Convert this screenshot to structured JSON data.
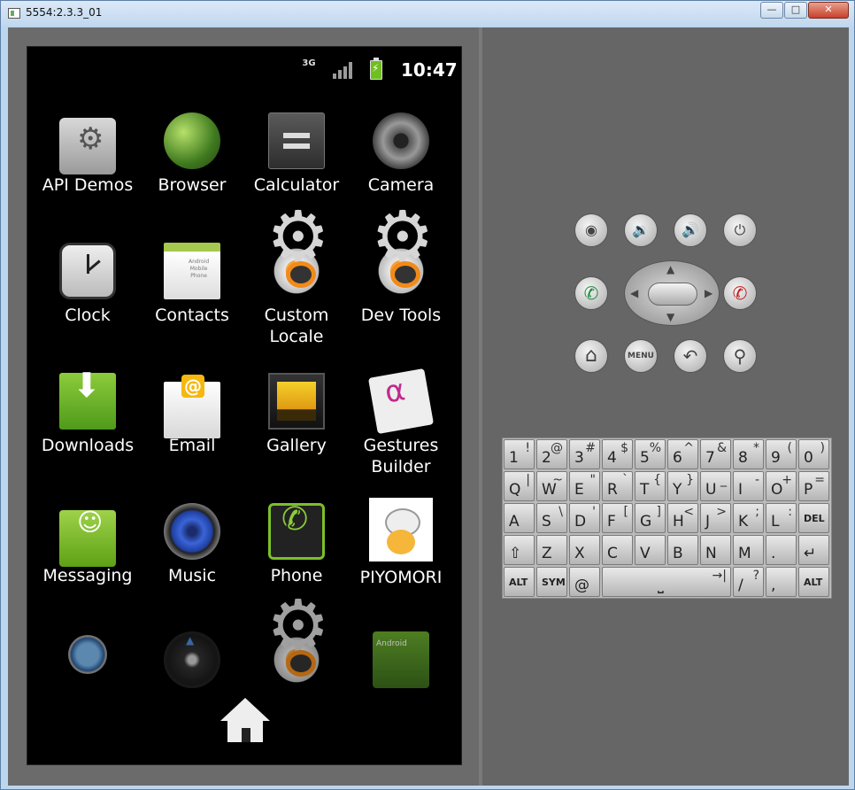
{
  "window": {
    "title": "5554:2.3.3_01",
    "minimize": "—",
    "maximize": "□",
    "close": "✕"
  },
  "status_bar": {
    "network": "3G",
    "time": "10:47"
  },
  "apps": [
    {
      "label": "API Demos",
      "icon": "folder-gear-icon"
    },
    {
      "label": "Browser",
      "icon": "globe-icon"
    },
    {
      "label": "Calculator",
      "icon": "calculator-icon"
    },
    {
      "label": "Camera",
      "icon": "camera-lens-icon"
    },
    {
      "label": "Clock",
      "icon": "clock-icon"
    },
    {
      "label": "Contacts",
      "icon": "contacts-card-icon"
    },
    {
      "label": "Custom\nLocale",
      "icon": "gear-icon"
    },
    {
      "label": "Dev Tools",
      "icon": "gear-icon"
    },
    {
      "label": "Downloads",
      "icon": "download-icon"
    },
    {
      "label": "Email",
      "icon": "envelope-icon"
    },
    {
      "label": "Gallery",
      "icon": "picture-frame-icon"
    },
    {
      "label": "Gestures\nBuilder",
      "icon": "gesture-icon"
    },
    {
      "label": "Messaging",
      "icon": "speech-bubble-icon"
    },
    {
      "label": "Music",
      "icon": "speaker-icon"
    },
    {
      "label": "Phone",
      "icon": "phone-handset-icon"
    },
    {
      "label": "PIYOMORI",
      "icon": "chick-icon"
    }
  ],
  "controls": {
    "camera": "◉",
    "volume_down": "🔉",
    "volume_up": "🔊",
    "power": "⏻",
    "call": "✆",
    "end_call": "✆",
    "home": "⌂",
    "menu": "MENU",
    "back": "↶",
    "search": "⚲",
    "up": "▲",
    "down": "▼",
    "left": "◀",
    "right": "▶"
  },
  "keyboard": {
    "row1": [
      {
        "m": "1",
        "a": "!"
      },
      {
        "m": "2",
        "a": "@"
      },
      {
        "m": "3",
        "a": "#"
      },
      {
        "m": "4",
        "a": "$"
      },
      {
        "m": "5",
        "a": "%"
      },
      {
        "m": "6",
        "a": "^"
      },
      {
        "m": "7",
        "a": "&"
      },
      {
        "m": "8",
        "a": "*"
      },
      {
        "m": "9",
        "a": "("
      },
      {
        "m": "0",
        "a": ")"
      }
    ],
    "row2": [
      {
        "m": "Q",
        "a": "|"
      },
      {
        "m": "W",
        "a": "~"
      },
      {
        "m": "E",
        "a": "\""
      },
      {
        "m": "R",
        "a": "`"
      },
      {
        "m": "T",
        "a": "{"
      },
      {
        "m": "Y",
        "a": "}"
      },
      {
        "m": "U",
        "a": "_"
      },
      {
        "m": "I",
        "a": "-"
      },
      {
        "m": "O",
        "a": "+"
      },
      {
        "m": "P",
        "a": "="
      }
    ],
    "row3": [
      {
        "m": "A",
        "a": ""
      },
      {
        "m": "S",
        "a": "\\"
      },
      {
        "m": "D",
        "a": "'"
      },
      {
        "m": "F",
        "a": "["
      },
      {
        "m": "G",
        "a": "]"
      },
      {
        "m": "H",
        "a": "<"
      },
      {
        "m": "J",
        "a": ">"
      },
      {
        "m": "K",
        "a": ";"
      },
      {
        "m": "L",
        "a": ":"
      },
      {
        "m": "DEL",
        "a": ""
      }
    ],
    "row4": [
      {
        "m": "⇧",
        "a": ""
      },
      {
        "m": "Z",
        "a": ""
      },
      {
        "m": "X",
        "a": ""
      },
      {
        "m": "C",
        "a": ""
      },
      {
        "m": "V",
        "a": ""
      },
      {
        "m": "B",
        "a": ""
      },
      {
        "m": "N",
        "a": ""
      },
      {
        "m": "M",
        "a": ""
      },
      {
        "m": ".",
        "a": ""
      },
      {
        "m": "↵",
        "a": ""
      }
    ],
    "row5": [
      {
        "m": "ALT",
        "a": ""
      },
      {
        "m": "SYM",
        "a": ""
      },
      {
        "m": "@",
        "a": ""
      },
      {
        "m": "⎵",
        "a": "→|"
      },
      {
        "m": "/",
        "a": "?"
      },
      {
        "m": ",",
        "a": ""
      },
      {
        "m": "ALT",
        "a": ""
      }
    ]
  }
}
